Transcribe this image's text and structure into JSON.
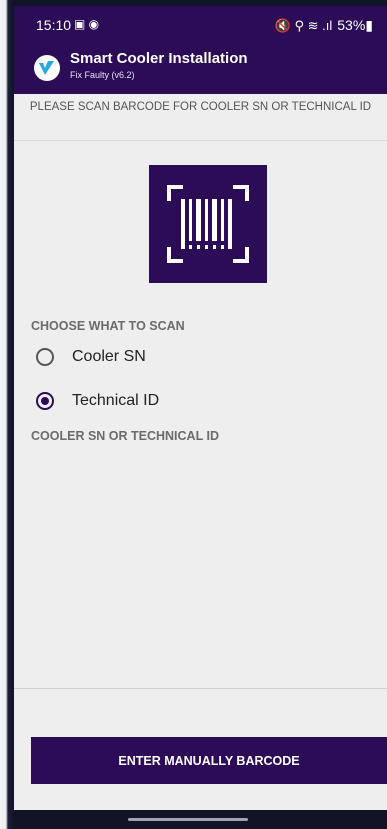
{
  "status_bar": {
    "time": "15:10",
    "left_icons": "▣ ◉",
    "right_icons": "🔇 ⚲ ≋ .ıl",
    "battery": "53%▮"
  },
  "app_bar": {
    "title": "Smart Cooler Installation",
    "subtitle": "Fix Faulty (v6.2)"
  },
  "instruction": "PLEASE SCAN BARCODE FOR COOLER SN OR TECHNICAL ID",
  "scan": {
    "icon": "barcode-scan-icon"
  },
  "choose_label": "CHOOSE WHAT TO SCAN",
  "options": [
    {
      "label": "Cooler SN",
      "selected": false
    },
    {
      "label": "Technical ID",
      "selected": true
    }
  ],
  "field_label": "COOLER SN OR TECHNICAL ID",
  "manual_button": "ENTER MANUALLY BARCODE",
  "colors": {
    "primary": "#2d0c57",
    "background": "#eeeeee"
  }
}
